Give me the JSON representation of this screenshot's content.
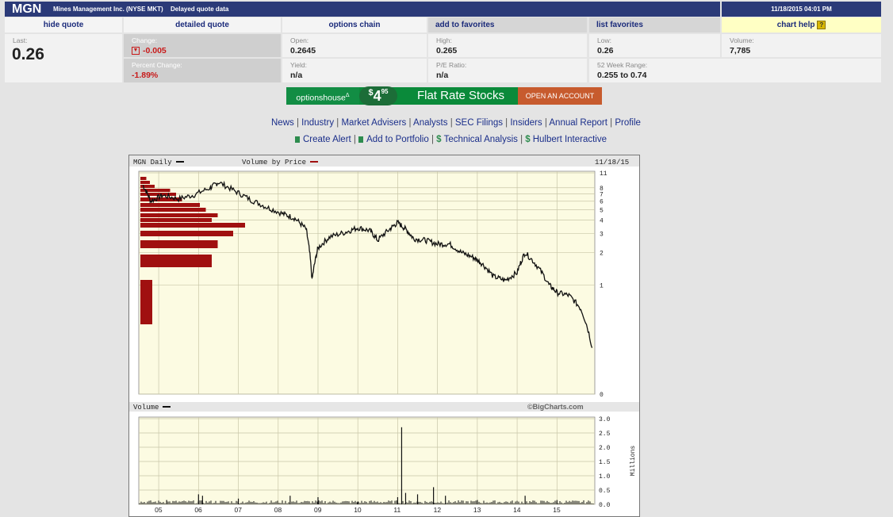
{
  "header": {
    "symbol": "MGN",
    "company": "Mines Management Inc. (NYSE MKT)",
    "delay_note": "Delayed quote data",
    "datetime": "11/18/2015 04:01 PM"
  },
  "tabs": {
    "hide_quote": "hide quote",
    "detailed_quote": "detailed quote",
    "options_chain": "options chain",
    "add_favorites": "add to favorites",
    "list_favorites": "list favorites",
    "chart_help": "chart help",
    "help_icon": "?"
  },
  "quote": {
    "last_label": "Last:",
    "last": "0.26",
    "change_label": "Change:",
    "change": "-0.005",
    "pct_change_label": "Percent Change:",
    "pct_change": "-1.89%",
    "open_label": "Open:",
    "open": "0.2645",
    "yield_label": "Yield:",
    "yield": "n/a",
    "high_label": "High:",
    "high": "0.265",
    "pe_label": "P/E Ratio:",
    "pe": "n/a",
    "low_label": "Low:",
    "low": "0.26",
    "range_label": "52 Week Range:",
    "range": "0.255 to 0.74",
    "volume_label": "Volume:",
    "volume": "7,785",
    "change_icon": "down-arrow-icon",
    "down_color": "#c81a1a"
  },
  "ad": {
    "logo": "optionshouse",
    "logo_mark": "Δ",
    "price_dollar": "$",
    "price_main": "4",
    "price_cents": "95",
    "headline": "Flat Rate Stocks",
    "cta": "OPEN AN ACCOUNT"
  },
  "nav_links": [
    "News",
    "Industry",
    "Market Advisers",
    "Analysts",
    "SEC Filings",
    "Insiders",
    "Annual Report",
    "Profile"
  ],
  "tool_links": {
    "create_alert": "Create Alert",
    "add_portfolio": "Add to Portfolio",
    "technical": "Technical Analysis",
    "hulbert": "Hulbert Interactive"
  },
  "chart": {
    "price_title": "MGN Daily",
    "vbp_title": "Volume by Price",
    "date": "11/18/15",
    "volume_title": "Volume",
    "credit": "©BigCharts.com",
    "volume_units": "Millions"
  },
  "chart_data": [
    {
      "type": "line",
      "title": "MGN Daily",
      "y_scale": "log",
      "y_ticks": [
        "11",
        "8",
        "7",
        "6",
        "5",
        "4",
        "3",
        "2",
        "1",
        "0"
      ],
      "x_ticks": [
        "05",
        "06",
        "07",
        "08",
        "09",
        "10",
        "11",
        "12",
        "13",
        "14",
        "15"
      ],
      "series": [
        {
          "name": "MGN Daily",
          "x": [
            2004.6,
            2004.8,
            2005.1,
            2005.5,
            2005.9,
            2006.3,
            2006.5,
            2006.9,
            2007.3,
            2007.7,
            2008.1,
            2008.4,
            2008.7,
            2008.85,
            2009.0,
            2009.3,
            2009.7,
            2010.0,
            2010.3,
            2010.5,
            2010.8,
            2011.0,
            2011.2,
            2011.4,
            2011.7,
            2012.0,
            2012.3,
            2012.6,
            2012.9,
            2013.1,
            2013.4,
            2013.7,
            2014.0,
            2014.2,
            2014.5,
            2014.8,
            2015.0,
            2015.3,
            2015.6,
            2015.88
          ],
          "values": [
            8.5,
            6.0,
            6.8,
            6.3,
            6.9,
            8.0,
            9.0,
            7.5,
            6.2,
            5.3,
            4.6,
            4.2,
            3.3,
            1.1,
            2.2,
            2.8,
            3.1,
            3.4,
            3.2,
            2.6,
            3.3,
            3.8,
            3.3,
            2.7,
            2.6,
            2.4,
            2.4,
            2.0,
            1.8,
            1.6,
            1.2,
            1.1,
            1.3,
            2.0,
            1.5,
            1.0,
            0.85,
            0.8,
            0.6,
            0.26
          ]
        }
      ],
      "volume_by_price": {
        "name": "Volume by Price",
        "note": "relative bar lengths by price level",
        "relative_values": [
          0.05,
          0.08,
          0.12,
          0.25,
          0.3,
          0.35,
          0.5,
          0.55,
          0.65,
          0.6,
          0.88,
          0.78,
          0.65,
          0.6,
          0.1
        ]
      }
    },
    {
      "type": "bar",
      "title": "Volume",
      "ylabel": "Millions",
      "ylim": [
        0,
        3.0
      ],
      "y_ticks": [
        "3.0",
        "2.5",
        "2.0",
        "1.5",
        "1.0",
        "0.5",
        "0.0"
      ],
      "x_ticks": [
        "05",
        "06",
        "07",
        "08",
        "09",
        "10",
        "11",
        "12",
        "13",
        "14",
        "15"
      ],
      "series": [
        {
          "name": "Volume",
          "x": [
            2005.2,
            2006.0,
            2006.1,
            2007.0,
            2008.3,
            2009.0,
            2010.0,
            2011.0,
            2011.1,
            2011.2,
            2011.5,
            2011.9,
            2012.2,
            2013.0,
            2014.2,
            2015.0
          ],
          "values": [
            0.15,
            0.35,
            0.3,
            0.2,
            0.3,
            0.25,
            0.1,
            0.25,
            2.7,
            0.4,
            0.35,
            0.6,
            0.3,
            0.15,
            0.3,
            0.15
          ]
        }
      ]
    }
  ]
}
